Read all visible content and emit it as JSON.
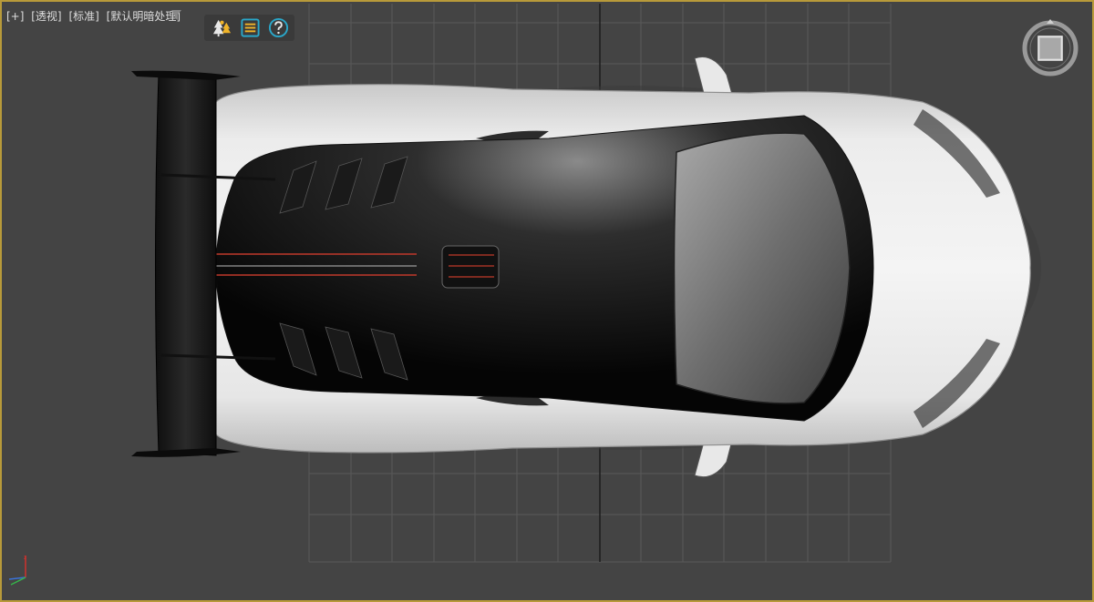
{
  "viewport": {
    "menu_plus": "[+]",
    "view_mode": "[透视]",
    "display_mode": "[标准]",
    "shading_mode": "[默认明暗处理]"
  },
  "toolbar": {
    "buttons": [
      "scene-explorer-icon",
      "layer-list-icon",
      "help-icon"
    ]
  },
  "colors": {
    "viewport_bg": "#444444",
    "grid_line": "#5a5a5a",
    "grid_axis": "#1c1c1c",
    "active_border": "#b89a3a",
    "toolbar_accent": "#2aa7c9"
  },
  "nav": {
    "viewcube": "viewcube-icon",
    "axis_gizmo": "axis-gizmo-icon"
  }
}
